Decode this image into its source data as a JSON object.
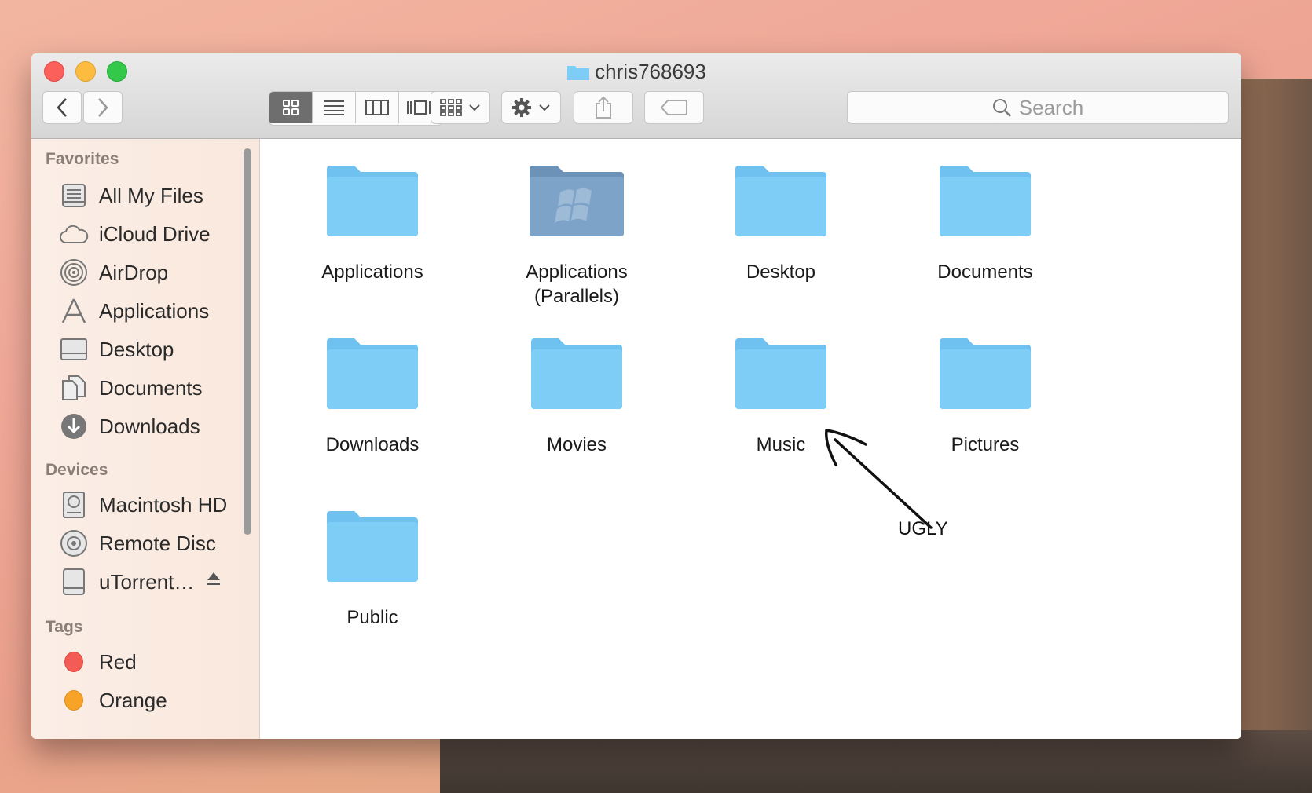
{
  "window": {
    "title": "chris768693"
  },
  "toolbar": {
    "search_placeholder": "Search"
  },
  "sidebar": {
    "favorites_header": "Favorites",
    "favorites": [
      {
        "label": "All My Files",
        "icon": "all-files-icon"
      },
      {
        "label": "iCloud Drive",
        "icon": "cloud-icon"
      },
      {
        "label": "AirDrop",
        "icon": "airdrop-icon"
      },
      {
        "label": "Applications",
        "icon": "applications-icon"
      },
      {
        "label": "Desktop",
        "icon": "desktop-icon"
      },
      {
        "label": "Documents",
        "icon": "documents-icon"
      },
      {
        "label": "Downloads",
        "icon": "downloads-icon"
      }
    ],
    "devices_header": "Devices",
    "devices": [
      {
        "label": "Macintosh HD",
        "icon": "hard-drive-icon"
      },
      {
        "label": "Remote Disc",
        "icon": "disc-icon"
      },
      {
        "label": "uTorrent…",
        "icon": "external-drive-icon"
      }
    ],
    "tags_header": "Tags",
    "tags": [
      {
        "label": "Red",
        "color": "#f25c54"
      },
      {
        "label": "Orange",
        "color": "#f7a328"
      }
    ]
  },
  "content": {
    "items": [
      {
        "label_line1": "Applications",
        "label_line2": ""
      },
      {
        "label_line1": "Applications",
        "label_line2": "(Parallels)"
      },
      {
        "label_line1": "Desktop",
        "label_line2": ""
      },
      {
        "label_line1": "Documents",
        "label_line2": ""
      },
      {
        "label_line1": "Downloads",
        "label_line2": ""
      },
      {
        "label_line1": "Movies",
        "label_line2": ""
      },
      {
        "label_line1": "Music",
        "label_line2": ""
      },
      {
        "label_line1": "Pictures",
        "label_line2": ""
      },
      {
        "label_line1": "Public",
        "label_line2": ""
      }
    ]
  },
  "annotation": {
    "text": "UGLY"
  },
  "colors": {
    "folder": "#7dcdf6",
    "folder_tab": "#6fc2f0",
    "parallels_folder": "#7ea3c8"
  }
}
